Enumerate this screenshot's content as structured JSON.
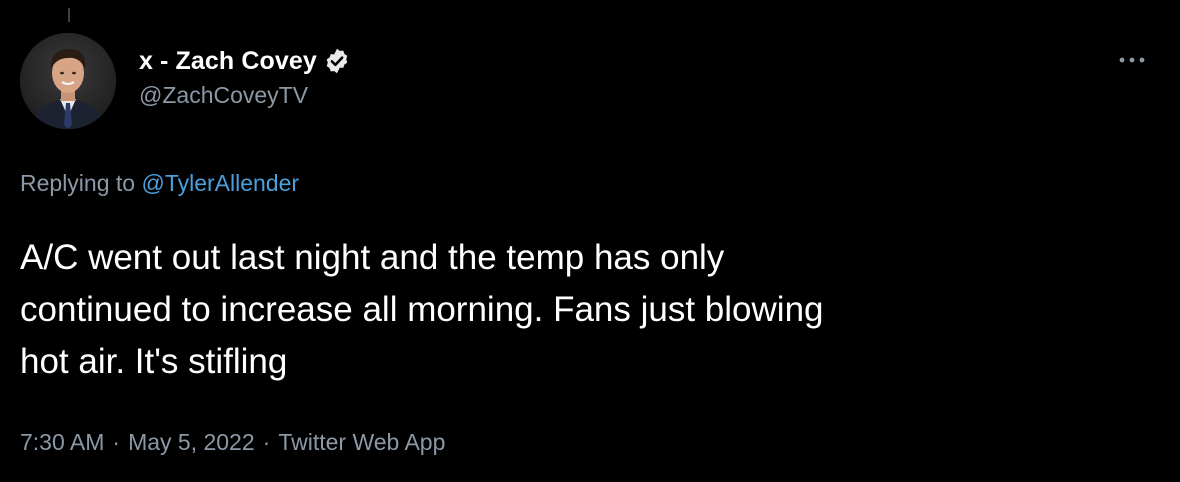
{
  "tweet": {
    "author": {
      "display_name": "x - Zach Covey",
      "handle": "@ZachCoveyTV",
      "verified": true
    },
    "reply": {
      "prefix": "Replying to",
      "mention": "@TylerAllender"
    },
    "text": "A/C went out last night and the temp has only\ncontinued to increase all morning. Fans just blowing\nhot air. It's stifling",
    "meta": {
      "time": "7:30 AM",
      "date": "May 5, 2022",
      "source": "Twitter Web App",
      "separator": "·"
    }
  },
  "colors": {
    "background": "#000000",
    "primary_text": "#ffffff",
    "secondary_text": "#8b98a5",
    "link": "#4a9fdc"
  },
  "icons": {
    "verified": "verified-badge-icon",
    "more": "more-options-icon"
  }
}
